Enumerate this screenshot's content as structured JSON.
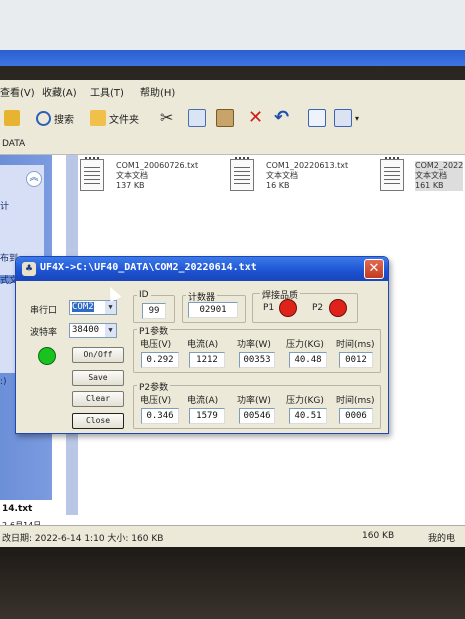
{
  "explorer": {
    "menu": [
      "查看(V)",
      "收藏(A)",
      "工具(T)",
      "帮助(H)"
    ],
    "toolbar": {
      "search_label": "搜索",
      "folders_label": "文件夹"
    },
    "address_partial": "DATA",
    "left_pane_labels": [
      "计",
      "布到",
      "式文",
      ":)"
    ],
    "files": [
      {
        "name": "COM1_20060726.txt",
        "type": "文本文档",
        "size": "137 KB"
      },
      {
        "name": "COM1_20220613.txt",
        "type": "文本文档",
        "size": "16 KB"
      },
      {
        "name": "COM2_2022",
        "type": "文本文档",
        "size": "161 KB"
      }
    ],
    "bottom_left_file": "14.txt",
    "bottom_left_date": "2-6月14日",
    "status": {
      "modified": "改日期: 2022-6-14 1:10 大小: 160 KB",
      "size": "160 KB",
      "zone": "我的电"
    }
  },
  "dialog": {
    "title": "UF4X->C:\\UF40_DATA\\COM2_20220614.txt",
    "port_label": "串行口",
    "port_value": "COM2",
    "baud_label": "波特率",
    "baud_value": "38400",
    "status_led_color": "#19c21f",
    "buttons": {
      "onoff": "On/Off",
      "save": "Save",
      "clear": "Clear",
      "close": "Close"
    },
    "id_label": "ID",
    "id_value": "99",
    "counter_label": "计数器",
    "counter_value": "02901",
    "quality_label": "焊接品质",
    "p1_label": "P1",
    "p2_label": "P2",
    "quality_led_color": "#e0231a",
    "p1_params_label": "P1参数",
    "p2_params_label": "P2参数",
    "cols": [
      "电压(V)",
      "电流(A)",
      "功率(W)",
      "压力(KG)",
      "时间(ms)"
    ],
    "p1_values": [
      "0.292",
      "1212",
      "00353",
      "40.48",
      "0012"
    ],
    "p2_values": [
      "0.346",
      "1579",
      "00546",
      "40.51",
      "0006"
    ]
  }
}
